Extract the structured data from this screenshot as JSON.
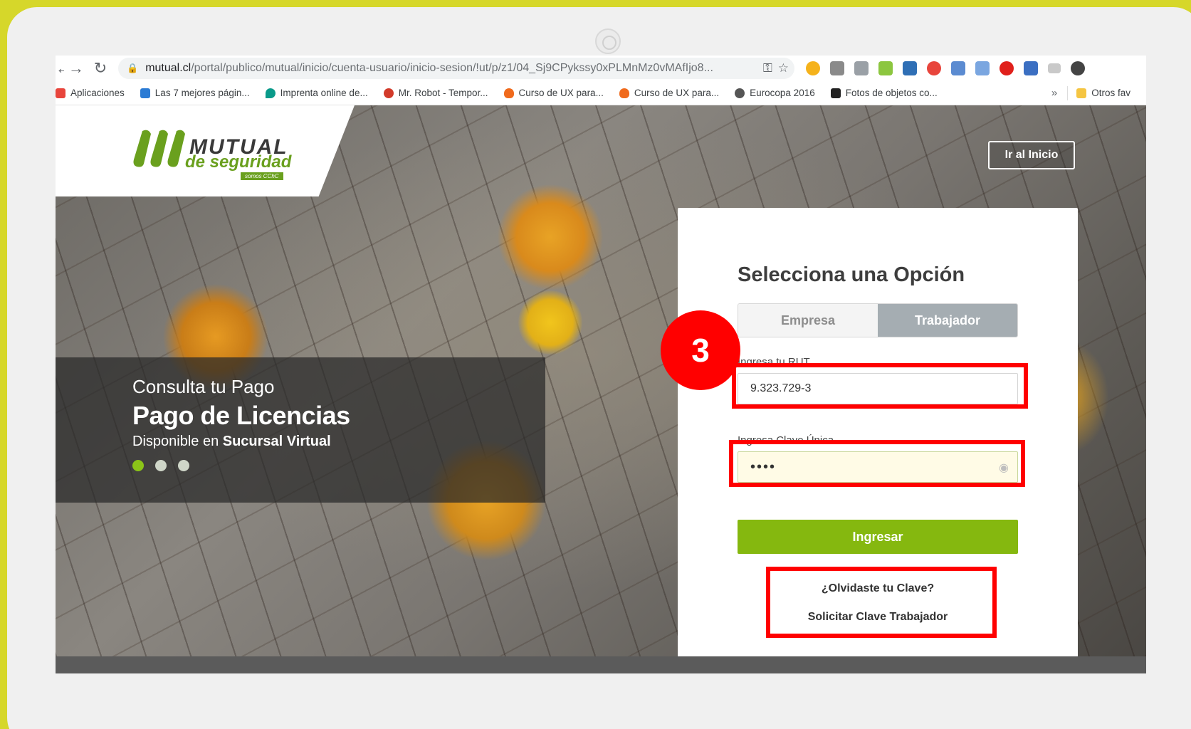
{
  "browser": {
    "url_host": "mutual.cl",
    "url_path": "/portal/publico/mutual/inicio/cuenta-usuario/inicio-sesion/!ut/p/z1/04_Sj9CPykssy0xPLMnMz0vMAfIjo8...",
    "bookmarks": [
      {
        "label": "Aplicaciones",
        "icon": "apps-grid-icon",
        "color": "#e8453c"
      },
      {
        "label": "Las 7 mejores págin...",
        "icon": "site-icon",
        "color": "#2b7bd4"
      },
      {
        "label": "Imprenta online de...",
        "icon": "drop-icon",
        "color": "#0a9a8a"
      },
      {
        "label": "Mr. Robot - Tempor...",
        "icon": "robot-icon",
        "color": "#d23a2a"
      },
      {
        "label": "Curso de UX para...",
        "icon": "flame-icon",
        "color": "#f06a1c"
      },
      {
        "label": "Curso de UX para...",
        "icon": "flame-icon",
        "color": "#f06a1c"
      },
      {
        "label": "Eurocopa 2016",
        "icon": "globe-icon",
        "color": "#555555"
      },
      {
        "label": "Fotos de objetos co...",
        "icon": "photo-icon",
        "color": "#222222"
      }
    ],
    "more": "»",
    "other_bookmarks": "Otros fav"
  },
  "page": {
    "header": {
      "logo_line1": "MUTUAL",
      "logo_line2": "de seguridad",
      "logo_badge": "somos CChC",
      "home_button": "Ir al Inicio"
    },
    "banner": {
      "subtitle": "Consulta tu Pago",
      "title": "Pago de Licencias",
      "desc_prefix": "Disponible en ",
      "desc_bold": "Sucursal Virtual",
      "slides": 3,
      "active_slide": 1
    },
    "login": {
      "title": "Selecciona una Opción",
      "tabs": [
        "Empresa",
        "Trabajador"
      ],
      "active_tab": "Trabajador",
      "rut_label": "Ingresa tu RUT",
      "rut_value": "9.323.729-3",
      "password_label": "Ingresa Clave Única",
      "password_value": "••••",
      "submit": "Ingresar",
      "forgot": "¿Olvidaste tu Clave?",
      "request": "Solicitar Clave Trabajador"
    }
  },
  "annotation": {
    "step_number": "3",
    "color": "#ff0000"
  },
  "colors": {
    "frame": "#d6d72a",
    "accent_green": "#85b80f",
    "tab_active": "#a5adb2"
  }
}
